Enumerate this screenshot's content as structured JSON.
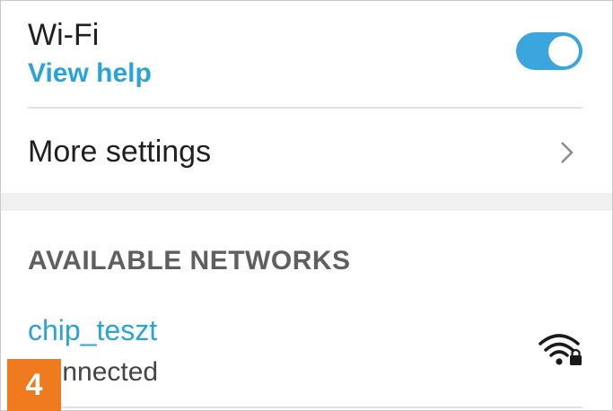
{
  "wifi": {
    "title": "Wi-Fi",
    "help_link": "View help",
    "toggle_on": true,
    "accent_color": "#3aa6dd"
  },
  "more_settings": {
    "label": "More settings",
    "icon": "chevron-right-icon"
  },
  "networks_section": {
    "header": "AVAILABLE NETWORKS",
    "items": [
      {
        "ssid": "chip_teszt",
        "status": "Connected",
        "icon": "wifi-locked-icon"
      }
    ]
  },
  "overlay_badge": {
    "text": "4",
    "color": "#f07b1f"
  }
}
